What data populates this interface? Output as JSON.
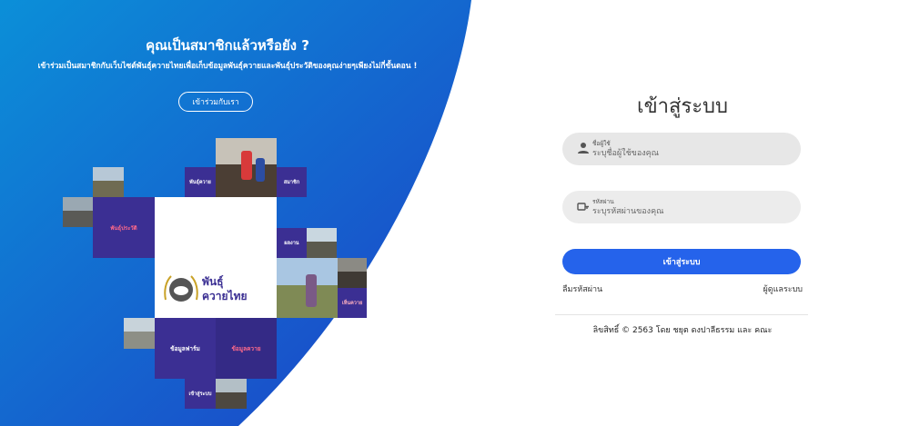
{
  "promo": {
    "title": "คุณเป็นสมาชิกแล้วหรือยัง ?",
    "description": "เข้าร่วมเป็นสมาชิกกับเว็บไซต์พันธุ์ควายไทยเพื่อเก็บข้อมูลพันธุ์ควายและพันธุ์ประวัติของคุณง่ายๆเพียงไม่กี่ขั้นตอน !",
    "join_button": "เข้าร่วมกับเรา"
  },
  "mosaic": {
    "tile_breed": "พันธุ์ควาย",
    "tile_member": "สมาชิก",
    "tile_history": "พันธุ์ประวัติ",
    "tile_dealer": "ผลงาน",
    "tile_exhibit": "เห็นควาย",
    "tile_farm_data": "ข้อมูลฟาร์ม",
    "tile_buffalo_data": "ข้อมูลควาย",
    "tile_login": "เข้าสู่ระบบ",
    "logo_line1": "พันธุ์",
    "logo_line2": "ควายไทย"
  },
  "login": {
    "title": "เข้าสู่ระบบ",
    "username_label": "ชื่อผู้ใช้",
    "username_placeholder": "ระบุชื่อผู้ใช้ของคุณ",
    "password_label": "รหัสผ่าน",
    "password_placeholder": "ระบุรหัสผ่านของคุณ",
    "submit_label": "เข้าสู่ระบบ",
    "forgot_password": "ลืมรหัสผ่าน",
    "admin_link": "ผู้ดูแลระบบ",
    "copyright": "ลิขสิทธิ์ © 2563 โดย ชยุต ดงปาลีธรรม และ คณะ"
  },
  "colors": {
    "gradient_start": "#0b8fd8",
    "gradient_end": "#1d3fc6",
    "tile_purple": "#3b2f93",
    "button_blue": "#2563eb"
  },
  "icons": {
    "username": "person-icon",
    "password": "key-icon",
    "logo": "buffalo-emblem-icon"
  }
}
